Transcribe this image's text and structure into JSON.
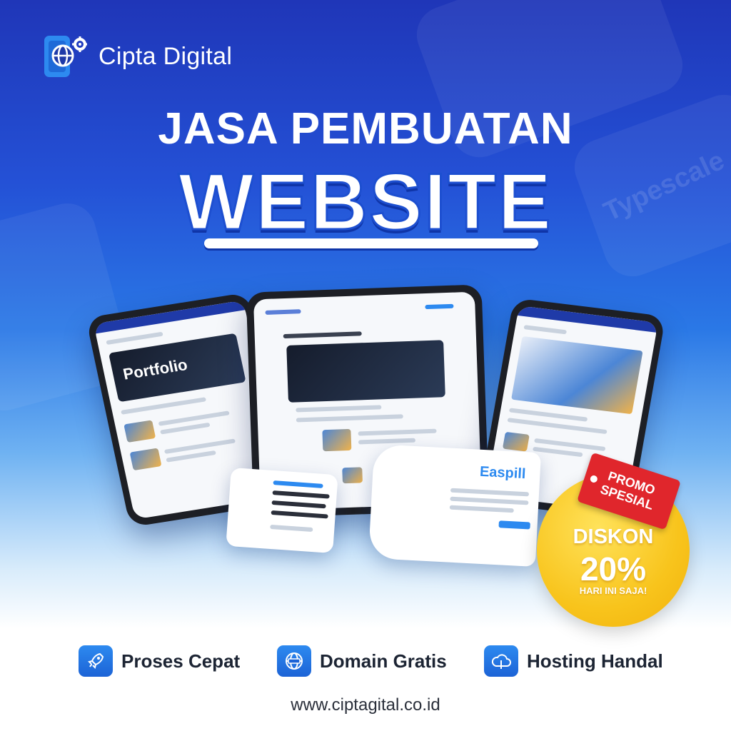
{
  "brand": {
    "name": "Cipta Digital"
  },
  "headline": {
    "line1": "JASA PEMBUATAN",
    "line2": "WEBSITE"
  },
  "promo": {
    "tag": "PROMO SPESIAL",
    "discount_label": "DISKON",
    "discount_value": "20%",
    "note": "HARI INI SAJA!"
  },
  "features": [
    {
      "label": "Proses Cepat",
      "icon": "rocket-icon"
    },
    {
      "label": "Domain Gratis",
      "icon": "globe-icon"
    },
    {
      "label": "Hosting Handal",
      "icon": "cloud-icon"
    }
  ],
  "mockups": {
    "left_phone_hero": "Portfolio",
    "paper_brand": "Easpill"
  },
  "website": "www.ciptagital.co.id",
  "colors": {
    "primary": "#1f4fd6",
    "accent": "#2d8af0",
    "promo_yellow": "#f8c41c",
    "promo_red": "#e0262c"
  }
}
